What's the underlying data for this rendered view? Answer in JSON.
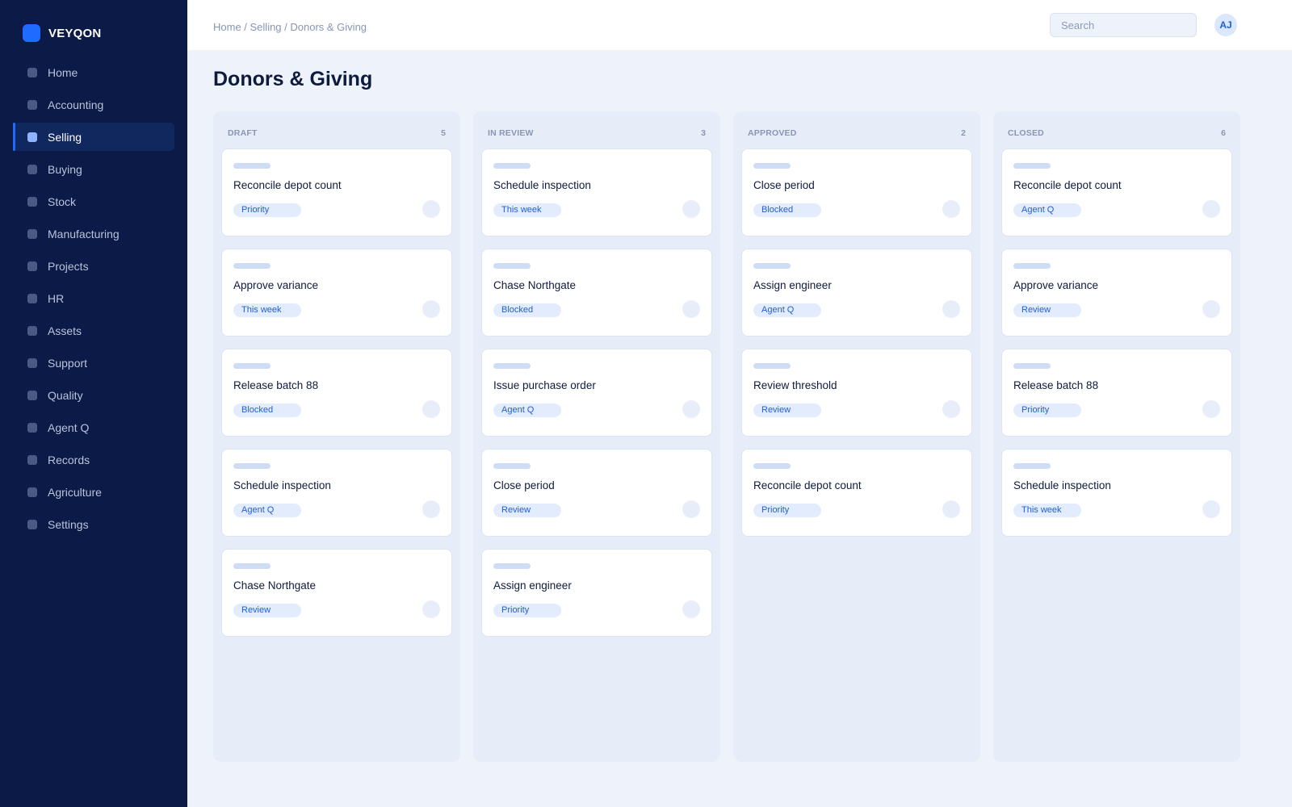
{
  "brand": {
    "name": "VEYQON"
  },
  "sidebar": {
    "items": [
      {
        "label": "Home",
        "icon": "home-icon",
        "active": false
      },
      {
        "label": "Accounting",
        "icon": "accounting-icon",
        "active": false
      },
      {
        "label": "Selling",
        "icon": "selling-icon",
        "active": true
      },
      {
        "label": "Buying",
        "icon": "buying-icon",
        "active": false
      },
      {
        "label": "Stock",
        "icon": "stock-icon",
        "active": false
      },
      {
        "label": "Manufacturing",
        "icon": "manufacturing-icon",
        "active": false
      },
      {
        "label": "Projects",
        "icon": "projects-icon",
        "active": false
      },
      {
        "label": "HR",
        "icon": "hr-icon",
        "active": false
      },
      {
        "label": "Assets",
        "icon": "assets-icon",
        "active": false
      },
      {
        "label": "Support",
        "icon": "support-icon",
        "active": false
      },
      {
        "label": "Quality",
        "icon": "quality-icon",
        "active": false
      },
      {
        "label": "Agent Q",
        "icon": "agent-icon",
        "active": false
      },
      {
        "label": "Records",
        "icon": "records-icon",
        "active": false
      },
      {
        "label": "Agriculture",
        "icon": "agriculture-icon",
        "active": false
      },
      {
        "label": "Settings",
        "icon": "settings-icon",
        "active": false
      }
    ]
  },
  "header": {
    "breadcrumb": "Home / Selling / Donors & Giving",
    "search_placeholder": "Search",
    "avatar_initials": "AJ"
  },
  "page": {
    "title": "Donors & Giving"
  },
  "colors": {
    "sidebar_bg": "#0b1a47",
    "accent": "#1f6bff",
    "tag_text": "#1f5fd6",
    "page_bg": "#eef2fa"
  },
  "board": {
    "columns": [
      {
        "title": "DRAFT",
        "count": "5",
        "cards": [
          {
            "title": "Reconcile depot count",
            "tag": "Priority"
          },
          {
            "title": "Approve variance",
            "tag": "This week"
          },
          {
            "title": "Release batch 88",
            "tag": "Blocked"
          },
          {
            "title": "Schedule inspection",
            "tag": "Agent Q"
          },
          {
            "title": "Chase Northgate",
            "tag": "Review"
          }
        ]
      },
      {
        "title": "IN REVIEW",
        "count": "3",
        "cards": [
          {
            "title": "Schedule inspection",
            "tag": "This week"
          },
          {
            "title": "Chase Northgate",
            "tag": "Blocked"
          },
          {
            "title": "Issue purchase order",
            "tag": "Agent Q"
          },
          {
            "title": "Close period",
            "tag": "Review"
          },
          {
            "title": "Assign engineer",
            "tag": "Priority"
          }
        ]
      },
      {
        "title": "APPROVED",
        "count": "2",
        "cards": [
          {
            "title": "Close period",
            "tag": "Blocked"
          },
          {
            "title": "Assign engineer",
            "tag": "Agent Q"
          },
          {
            "title": "Review threshold",
            "tag": "Review"
          },
          {
            "title": "Reconcile depot count",
            "tag": "Priority"
          }
        ]
      },
      {
        "title": "CLOSED",
        "count": "6",
        "cards": [
          {
            "title": "Reconcile depot count",
            "tag": "Agent Q"
          },
          {
            "title": "Approve variance",
            "tag": "Review"
          },
          {
            "title": "Release batch 88",
            "tag": "Priority"
          },
          {
            "title": "Schedule inspection",
            "tag": "This week"
          }
        ]
      }
    ]
  }
}
